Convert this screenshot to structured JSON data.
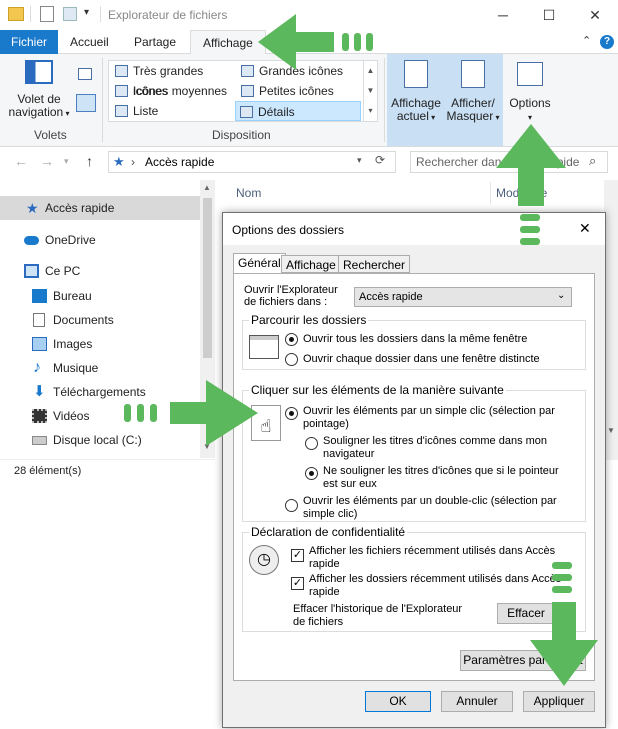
{
  "window": {
    "title": "Explorateur de fichiers"
  },
  "ribbon_tabs": [
    "Fichier",
    "Accueil",
    "Partage",
    "Affichage"
  ],
  "ribbon": {
    "volets": {
      "button_label_1": "Volet de",
      "button_label_2": "navigation",
      "group": "Volets"
    },
    "layout_options": [
      "Très grandes icônes",
      "Grandes icônes",
      "Icônes moyennes",
      "Petites icônes",
      "Liste",
      "Détails"
    ],
    "disposition_group": "Disposition",
    "affichage_actuel": {
      "line1": "Affichage",
      "line2": "actuel"
    },
    "afficher_masquer": {
      "line1": "Afficher/",
      "line2": "Masquer"
    },
    "options": "Options"
  },
  "address": {
    "path": "Accès rapide",
    "search_placeholder": "Rechercher dans Accès rapide"
  },
  "columns": {
    "name": "Nom",
    "modified": "Modifié le"
  },
  "nav": {
    "items": [
      "Accès rapide",
      "OneDrive",
      "Ce PC",
      "Bureau",
      "Documents",
      "Images",
      "Musique",
      "Téléchargements",
      "Vidéos",
      "Disque local (C:)"
    ],
    "status": "28 élément(s)"
  },
  "dialog": {
    "title": "Options des dossiers",
    "tabs": [
      "Général",
      "Affichage",
      "Rechercher"
    ],
    "open_label_1": "Ouvrir l'Explorateur",
    "open_label_2": "de fichiers dans :",
    "open_value": "Accès rapide",
    "browse": {
      "legend": "Parcourir les dossiers",
      "opt1": "Ouvrir tous les dossiers dans la même fenêtre",
      "opt2": "Ouvrir chaque dossier dans une fenêtre distincte"
    },
    "click": {
      "legend": "Cliquer sur les éléments de la manière suivante",
      "single_1": "Ouvrir les éléments par un simple clic (sélection par",
      "single_2": "pointage)",
      "underline_all_1": "Souligner les titres d'icônes comme dans mon",
      "underline_all_2": "navigateur",
      "underline_hover_1": "Ne souligner les titres d'icônes que si le pointeur",
      "underline_hover_2": "est sur eux",
      "double_1": "Ouvrir les éléments par un double-clic (sélection par",
      "double_2": "simple clic)"
    },
    "privacy": {
      "legend": "Déclaration de confidentialité",
      "files_1": "Afficher les fichiers récemment utilisés dans Accès",
      "files_2": "rapide",
      "folders_1": "Afficher les dossiers récemment utilisés dans Accès",
      "folders_2": "rapide",
      "clear_1": "Effacer l'historique de l'Explorateur",
      "clear_2": "de fichiers",
      "clear_button": "Effacer"
    },
    "defaults_button": "Paramètres par défaut",
    "ok": "OK",
    "cancel": "Annuler",
    "apply": "Appliquer"
  },
  "colors": {
    "accent": "#1979ca",
    "arrow": "#5cb85c"
  }
}
